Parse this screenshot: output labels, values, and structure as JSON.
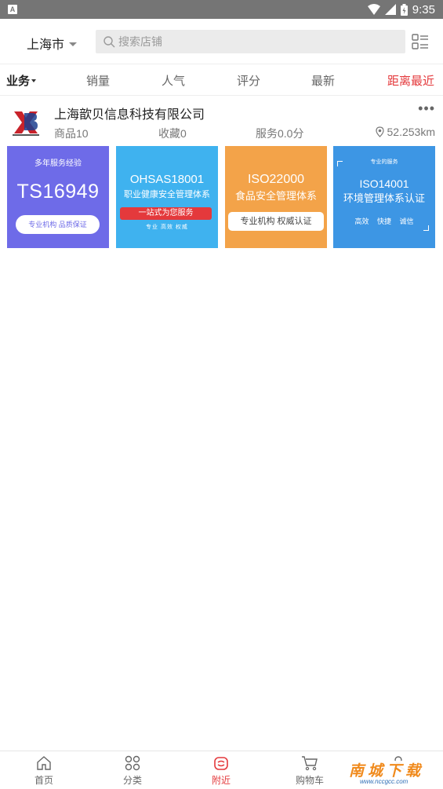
{
  "status_bar": {
    "time": "9:35"
  },
  "header": {
    "city": "上海市",
    "search_placeholder": "搜索店铺"
  },
  "sort_tabs": [
    {
      "label": "业务"
    },
    {
      "label": "销量"
    },
    {
      "label": "人气"
    },
    {
      "label": "评分"
    },
    {
      "label": "最新"
    },
    {
      "label": "距离最近"
    }
  ],
  "shop": {
    "name": "上海歆贝信息科技有限公司",
    "goods": "商品10",
    "favorites": "收藏0",
    "service": "服务0.0分",
    "distance": "52.253km",
    "banners": [
      {
        "top": "多年服务经验",
        "big": "TS16949",
        "pill": "专业机构  品质保证"
      },
      {
        "big": "OHSAS18001",
        "sub": "职业健康安全管理体系",
        "bar": "一站式为您服务",
        "small": "专业  高效  权威"
      },
      {
        "big": "ISO22000",
        "sub": "食品安全管理体系",
        "pill": "专业机构  权威认证"
      },
      {
        "top": "专业的服务",
        "big": "ISO14001",
        "sub": "环境管理体系认证",
        "small": "高效 快捷 诚信"
      }
    ]
  },
  "bottom_nav": [
    {
      "label": "首页",
      "icon": "home-icon"
    },
    {
      "label": "分类",
      "icon": "category-icon"
    },
    {
      "label": "附近",
      "icon": "nearby-icon"
    },
    {
      "label": "购物车",
      "icon": "cart-icon"
    }
  ],
  "watermark": {
    "title": "南城下载",
    "url": "www.nccgcc.com"
  },
  "colors": {
    "accent": "#e4393c",
    "banner1": "#6e6be8",
    "banner2": "#3fb2ef",
    "banner3": "#f3a349",
    "banner4": "#3d96e4"
  }
}
